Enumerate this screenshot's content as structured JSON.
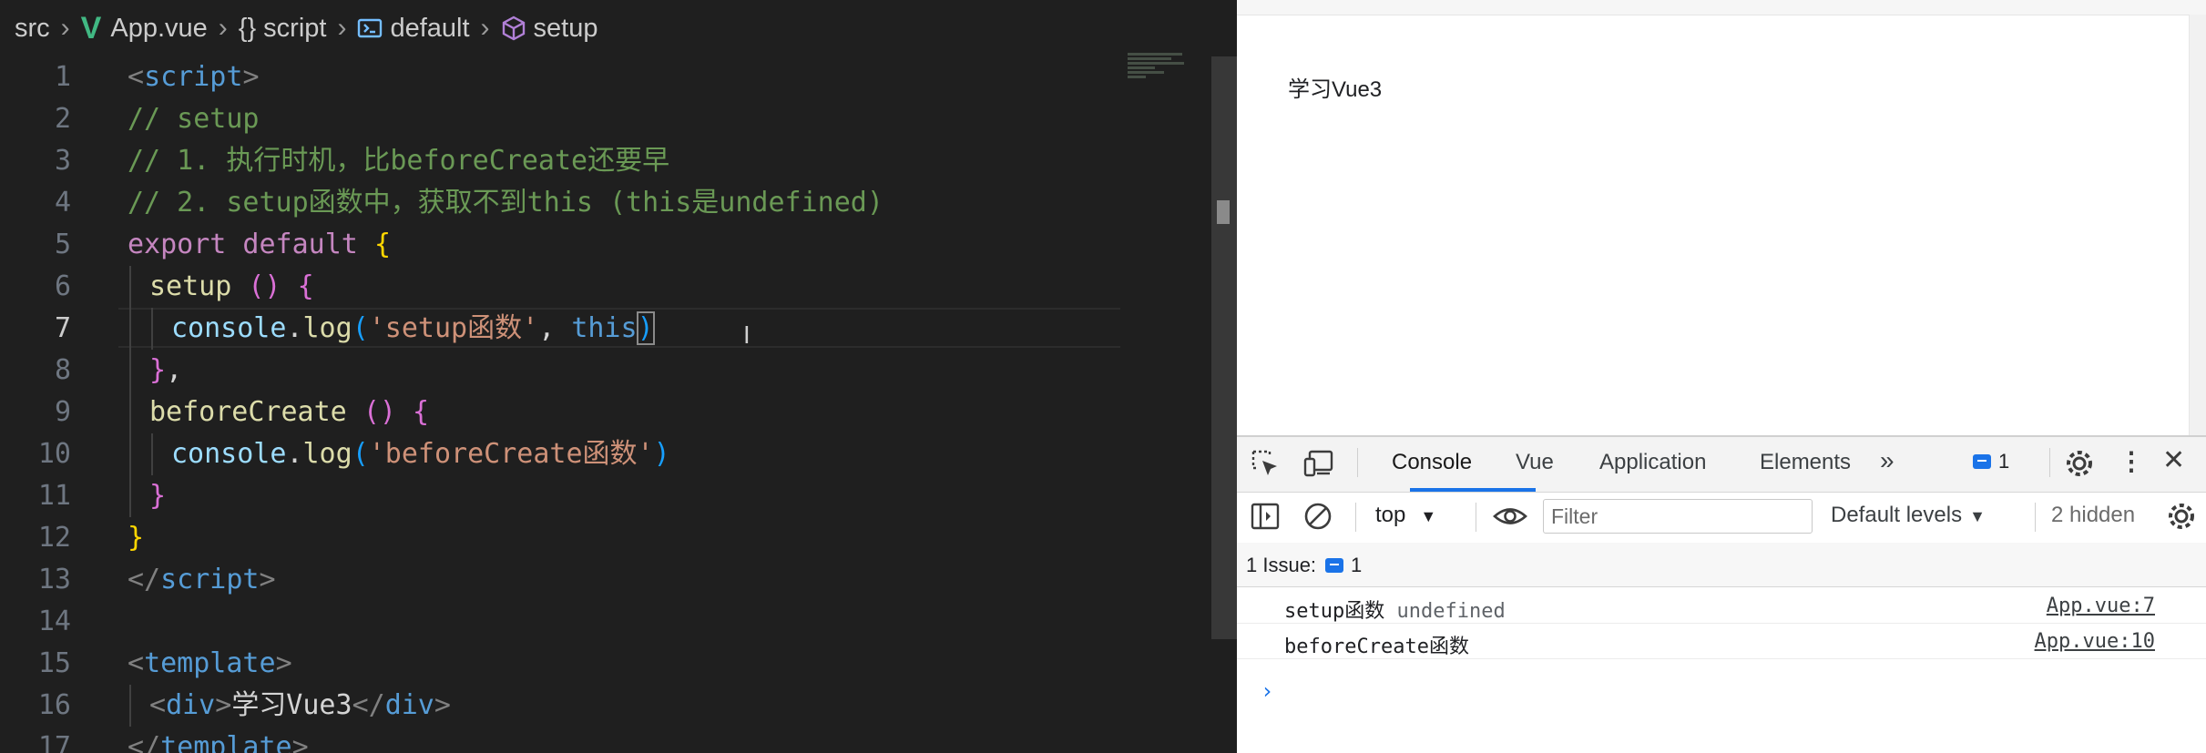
{
  "editor": {
    "breadcrumb": [
      "src",
      "App.vue",
      "script",
      "default",
      "setup"
    ],
    "lines": [
      {
        "n": "1",
        "indent": 0,
        "t": [
          {
            "c": "tg",
            "s": "<"
          },
          {
            "c": "tn",
            "s": "script"
          },
          {
            "c": "tg",
            "s": ">"
          }
        ]
      },
      {
        "n": "2",
        "indent": 0,
        "t": [
          {
            "c": "cm",
            "s": "// setup"
          }
        ]
      },
      {
        "n": "3",
        "indent": 0,
        "t": [
          {
            "c": "cm",
            "s": "// 1. 执行时机，比beforeCreate还要早"
          }
        ]
      },
      {
        "n": "4",
        "indent": 0,
        "t": [
          {
            "c": "cm",
            "s": "// 2. setup函数中，获取不到this (this是undefined)"
          }
        ]
      },
      {
        "n": "5",
        "indent": 0,
        "t": [
          {
            "c": "kw",
            "s": "export default "
          },
          {
            "c": "b1",
            "s": "{"
          }
        ]
      },
      {
        "n": "6",
        "indent": 1,
        "t": [
          {
            "c": "fn",
            "s": "setup "
          },
          {
            "c": "b2",
            "s": "()"
          },
          {
            "c": "pl",
            "s": " "
          },
          {
            "c": "b2",
            "s": "{"
          }
        ]
      },
      {
        "n": "7",
        "indent": 2,
        "active": true,
        "t": [
          {
            "c": "id",
            "s": "console"
          },
          {
            "c": "pl",
            "s": "."
          },
          {
            "c": "fn",
            "s": "log"
          },
          {
            "c": "b3",
            "s": "("
          },
          {
            "c": "st",
            "s": "'setup函数'"
          },
          {
            "c": "pl",
            "s": ", "
          },
          {
            "c": "th",
            "s": "this"
          },
          {
            "c": "b3 caret-box",
            "s": ")"
          }
        ]
      },
      {
        "n": "8",
        "indent": 1,
        "t": [
          {
            "c": "b2",
            "s": "}"
          },
          {
            "c": "pl",
            "s": ","
          }
        ]
      },
      {
        "n": "9",
        "indent": 1,
        "t": [
          {
            "c": "fn",
            "s": "beforeCreate "
          },
          {
            "c": "b2",
            "s": "()"
          },
          {
            "c": "pl",
            "s": " "
          },
          {
            "c": "b2",
            "s": "{"
          }
        ]
      },
      {
        "n": "10",
        "indent": 2,
        "t": [
          {
            "c": "id",
            "s": "console"
          },
          {
            "c": "pl",
            "s": "."
          },
          {
            "c": "fn",
            "s": "log"
          },
          {
            "c": "b3",
            "s": "("
          },
          {
            "c": "st",
            "s": "'beforeCreate函数'"
          },
          {
            "c": "b3",
            "s": ")"
          }
        ]
      },
      {
        "n": "11",
        "indent": 1,
        "t": [
          {
            "c": "b2",
            "s": "}"
          }
        ]
      },
      {
        "n": "12",
        "indent": 0,
        "t": [
          {
            "c": "b1",
            "s": "}"
          }
        ]
      },
      {
        "n": "13",
        "indent": 0,
        "t": [
          {
            "c": "tg",
            "s": "</"
          },
          {
            "c": "tn",
            "s": "script"
          },
          {
            "c": "tg",
            "s": ">"
          }
        ]
      },
      {
        "n": "14",
        "indent": 0,
        "t": []
      },
      {
        "n": "15",
        "indent": 0,
        "t": [
          {
            "c": "tg",
            "s": "<"
          },
          {
            "c": "tn",
            "s": "template"
          },
          {
            "c": "tg",
            "s": ">"
          }
        ]
      },
      {
        "n": "16",
        "indent": 1,
        "t": [
          {
            "c": "tg",
            "s": "<"
          },
          {
            "c": "tn",
            "s": "div"
          },
          {
            "c": "tg",
            "s": ">"
          },
          {
            "c": "pl",
            "s": "学习Vue3"
          },
          {
            "c": "tg",
            "s": "</"
          },
          {
            "c": "tn",
            "s": "div"
          },
          {
            "c": "tg",
            "s": ">"
          }
        ]
      },
      {
        "n": "17",
        "indent": 0,
        "t": [
          {
            "c": "tg",
            "s": "</"
          },
          {
            "c": "tn",
            "s": "template"
          },
          {
            "c": "tg",
            "s": ">"
          }
        ]
      }
    ]
  },
  "browser": {
    "page_text": "学习Vue3",
    "devtools": {
      "tabs": [
        "Console",
        "Vue",
        "Application",
        "Elements"
      ],
      "more_tabs": "»",
      "issue_badge": "1",
      "context": "top",
      "filter_placeholder": "Filter",
      "levels": "Default levels",
      "hidden": "2 hidden",
      "issues_label": "1 Issue:",
      "issues_count": "1",
      "logs": [
        {
          "msg": "setup函数",
          "val": "undefined",
          "src": "App.vue:7"
        },
        {
          "msg": "beforeCreate函数",
          "val": "",
          "src": "App.vue:10"
        }
      ],
      "prompt": "›"
    }
  }
}
